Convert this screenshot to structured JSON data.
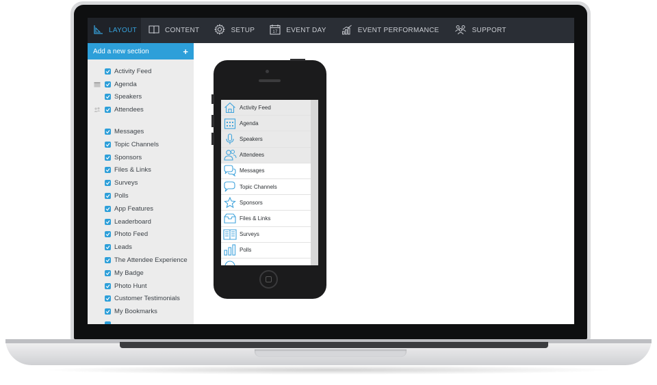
{
  "nav": {
    "items": [
      {
        "label": "LAYOUT",
        "icon": "layout-icon",
        "active": true
      },
      {
        "label": "CONTENT",
        "icon": "book-icon"
      },
      {
        "label": "SETUP",
        "icon": "gear-icon"
      },
      {
        "label": "EVENT DAY",
        "icon": "calendar-icon"
      },
      {
        "label": "EVENT PERFORMANCE",
        "icon": "bar-chart-icon"
      },
      {
        "label": "SUPPORT",
        "icon": "people-icon"
      }
    ]
  },
  "sidebar": {
    "add_section_label": "Add a new section",
    "add_icon": "+",
    "items": [
      {
        "label": "Activity Feed",
        "checked": true
      },
      {
        "label": "Agenda",
        "checked": true,
        "icon": "calendar-icon"
      },
      {
        "label": "Speakers",
        "checked": true
      },
      {
        "label": "Attendees",
        "checked": true,
        "icon": "people-icon"
      },
      {
        "label": "Messages",
        "checked": true
      },
      {
        "label": "Topic Channels",
        "checked": true
      },
      {
        "label": "Sponsors",
        "checked": true
      },
      {
        "label": "Files & Links",
        "checked": true
      },
      {
        "label": "Surveys",
        "checked": true
      },
      {
        "label": "Polls",
        "checked": true
      },
      {
        "label": "App Features",
        "checked": true
      },
      {
        "label": "Leaderboard",
        "checked": true
      },
      {
        "label": "Photo Feed",
        "checked": true
      },
      {
        "label": "Leads",
        "checked": true
      },
      {
        "label": "The Attendee Experience",
        "checked": true
      },
      {
        "label": "My Badge",
        "checked": true
      },
      {
        "label": "Photo Hunt",
        "checked": true
      },
      {
        "label": "Customer Testimonials",
        "checked": true
      },
      {
        "label": "My Bookmarks",
        "checked": true
      }
    ]
  },
  "phone_menu": [
    {
      "label": "Activity Feed",
      "icon": "home-icon"
    },
    {
      "label": "Agenda",
      "icon": "calendar-icon"
    },
    {
      "label": "Speakers",
      "icon": "microphone-icon"
    },
    {
      "label": "Attendees",
      "icon": "people-icon"
    },
    {
      "label": "Messages",
      "icon": "chat-bubbles-icon"
    },
    {
      "label": "Topic Channels",
      "icon": "chat-bubble-icon"
    },
    {
      "label": "Sponsors",
      "icon": "star-icon"
    },
    {
      "label": "Files & Links",
      "icon": "inbox-icon"
    },
    {
      "label": "Surveys",
      "icon": "open-book-icon"
    },
    {
      "label": "Polls",
      "icon": "bar-chart-icon"
    }
  ],
  "colors": {
    "accent": "#2d9fd9",
    "nav_bg": "#2a2e35",
    "nav_text": "#c9ccd2",
    "sidebar_bg": "#ececec"
  }
}
